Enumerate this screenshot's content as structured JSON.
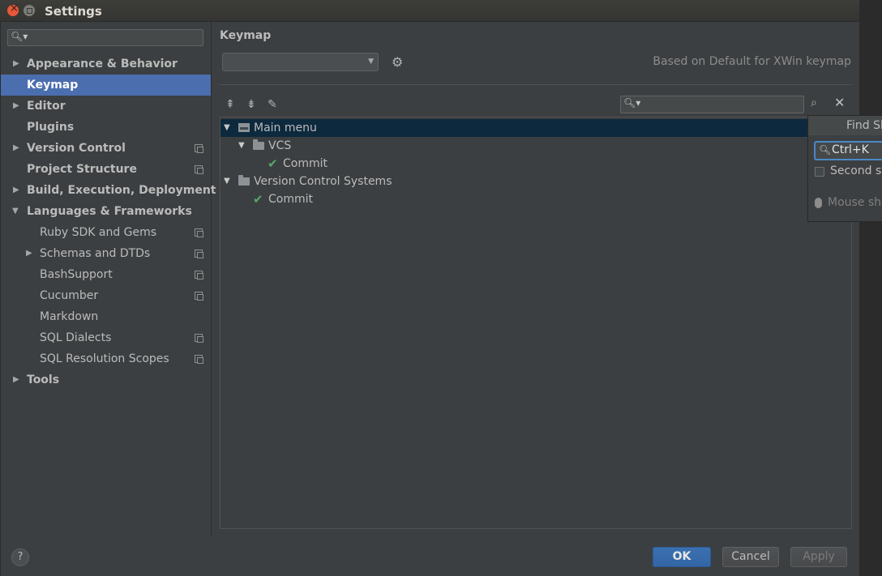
{
  "window": {
    "title": "Settings"
  },
  "sidebar": {
    "search_placeholder": "",
    "items": [
      {
        "label": "Appearance & Behavior",
        "expandable": true
      },
      {
        "label": "Keymap",
        "selected": true
      },
      {
        "label": "Editor",
        "expandable": true
      },
      {
        "label": "Plugins"
      },
      {
        "label": "Version Control",
        "expandable": true,
        "project_level": true
      },
      {
        "label": "Project Structure",
        "project_level": true
      },
      {
        "label": "Build, Execution, Deployment",
        "expandable": true
      },
      {
        "label": "Languages & Frameworks",
        "expanded": true
      },
      {
        "label": "Ruby SDK and Gems",
        "project_level": true
      },
      {
        "label": "Schemas and DTDs",
        "expandable": true,
        "project_level": true
      },
      {
        "label": "BashSupport",
        "project_level": true
      },
      {
        "label": "Cucumber",
        "project_level": true
      },
      {
        "label": "Markdown"
      },
      {
        "label": "SQL Dialects",
        "project_level": true
      },
      {
        "label": "SQL Resolution Scopes",
        "project_level": true
      },
      {
        "label": "Tools",
        "expandable": true
      }
    ]
  },
  "main": {
    "title": "Keymap",
    "keymap_select_value": "",
    "based_on": "Based on Default for XWin keymap",
    "search_value": "",
    "tree": [
      {
        "label": "Main menu",
        "icon": "menu-icon",
        "expanded": true,
        "selected": true
      },
      {
        "label": "VCS",
        "icon": "folder-icon",
        "expanded": true
      },
      {
        "label": "Commit",
        "icon": "check-icon"
      },
      {
        "label": "Version Control Systems",
        "icon": "folder-icon",
        "expanded": true
      },
      {
        "label": "Commit",
        "icon": "check-icon"
      }
    ]
  },
  "popup": {
    "title": "Find Sh",
    "shortcut_value": "Ctrl+K",
    "second_stroke_label": "Second st",
    "mouse_label": "Mouse sho"
  },
  "footer": {
    "help_label": "?",
    "ok_label": "OK",
    "cancel_label": "Cancel",
    "apply_label": "Apply"
  },
  "colors": {
    "selection": "#4b6eaf",
    "tree_selection": "#0d293e",
    "check": "#59a869",
    "accent_border": "#4a88c7"
  }
}
